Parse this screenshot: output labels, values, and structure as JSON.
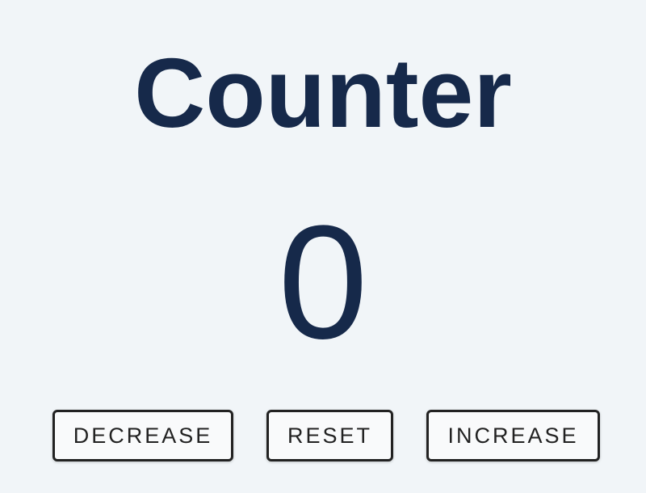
{
  "counter": {
    "title": "Counter",
    "value": "0"
  },
  "buttons": {
    "decrease_label": "DECREASE",
    "reset_label": "RESET",
    "increase_label": "INCREASE"
  },
  "colors": {
    "background": "#f1f5f8",
    "text": "#16294a",
    "button_border": "#222222"
  }
}
